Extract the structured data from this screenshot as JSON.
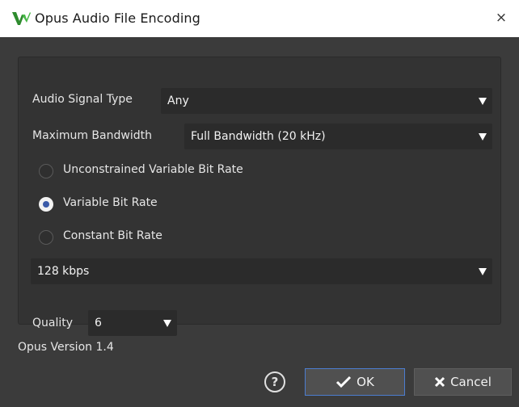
{
  "window": {
    "title": "Opus Audio File Encoding",
    "close_symbol": "×",
    "app_icon": "wavelab-logo-icon"
  },
  "signal_type": {
    "label": "Audio Signal Type",
    "value": "Any"
  },
  "bandwidth": {
    "label": "Maximum Bandwidth",
    "value": "Full Bandwidth (20 kHz)"
  },
  "bitrate_modes": [
    {
      "label": "Unconstrained Variable Bit Rate",
      "selected": false
    },
    {
      "label": "Variable Bit Rate",
      "selected": true
    },
    {
      "label": "Constant Bit Rate",
      "selected": false
    }
  ],
  "bitrate": {
    "value": "128 kbps"
  },
  "quality": {
    "label": "Quality",
    "value": "6"
  },
  "version_text": "Opus Version 1.4",
  "buttons": {
    "help_symbol": "?",
    "ok_label": "OK",
    "cancel_label": "Cancel"
  },
  "colors": {
    "dialog_bg": "#3b3b3b",
    "panel_bg": "#333333",
    "combo_bg": "#2b2b2b",
    "ok_border": "#4c7dd0",
    "radio_dot": "#3a5aa8"
  }
}
